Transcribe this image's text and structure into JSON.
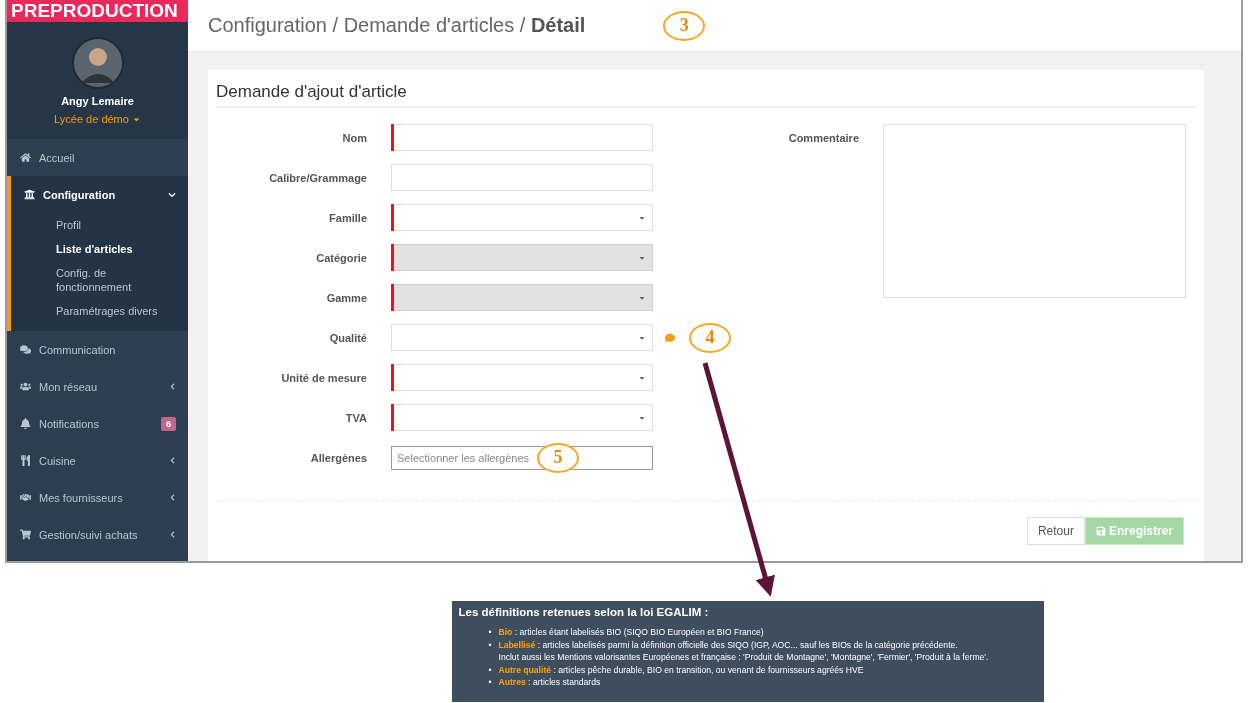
{
  "environment_banner": "PREPRODUCTION",
  "user": {
    "name": "Angy Lemaire",
    "school": "Lycée de démo"
  },
  "sidebar": {
    "items": [
      {
        "kind": "home",
        "label": "Accueil",
        "selected": false,
        "has_submenu": false
      },
      {
        "kind": "bank",
        "label": "Configuration",
        "selected": true,
        "expanded": true,
        "has_submenu": true,
        "children": [
          {
            "label": "Profil",
            "selected": false
          },
          {
            "label": "Liste d'articles",
            "selected": true
          },
          {
            "label": "Config. de fonctionnement",
            "selected": false
          },
          {
            "label": "Paramétrages divers",
            "selected": false
          }
        ]
      },
      {
        "kind": "comments",
        "label": "Communication",
        "selected": false,
        "has_submenu": false
      },
      {
        "kind": "users",
        "label": "Mon réseau",
        "selected": false,
        "has_submenu": true
      },
      {
        "kind": "bell",
        "label": "Notifications",
        "selected": false,
        "has_submenu": false,
        "badge": "6"
      },
      {
        "kind": "utensils",
        "label": "Cuisine",
        "selected": false,
        "has_submenu": true
      },
      {
        "kind": "handshake",
        "label": "Mes fournisseurs",
        "selected": false,
        "has_submenu": true
      },
      {
        "kind": "cart",
        "label": "Gestion/suivi achats",
        "selected": false,
        "has_submenu": true
      }
    ]
  },
  "header": {
    "breadcrumb": "Configuration / Demande d'articles / **Détail**",
    "annotation": "3"
  },
  "form": {
    "title": "Demande d'ajout d'article",
    "fields": [
      {
        "kind": "text",
        "label": "Nom",
        "required": true,
        "disabled": false
      },
      {
        "kind": "text",
        "label": "Calibre/Grammage",
        "required": false,
        "disabled": false
      },
      {
        "kind": "select",
        "label": "Famille",
        "required": true,
        "disabled": false
      },
      {
        "kind": "select",
        "label": "Catégorie",
        "required": true,
        "disabled": true
      },
      {
        "kind": "select",
        "label": "Gamme",
        "required": true,
        "disabled": true
      },
      {
        "kind": "select",
        "label": "Qualité",
        "required": false,
        "disabled": false,
        "has_info": true,
        "annotation": "4"
      },
      {
        "kind": "select",
        "label": "Unité de mesure",
        "required": true,
        "disabled": false
      },
      {
        "kind": "select",
        "label": "TVA",
        "required": true,
        "disabled": false
      },
      {
        "kind": "multiselect",
        "label": "Allergènes",
        "placeholder": "Selectionner les allergènes",
        "annotation": "5"
      }
    ],
    "comment": {
      "label": "Commentaire"
    },
    "buttons": [
      {
        "kind": "default",
        "label": "Retour",
        "disabled": false
      },
      {
        "kind": "save",
        "label": "Enregistrer",
        "disabled": true
      }
    ]
  },
  "tooltip": {
    "title": "Les définitions retenues selon la loi EGALIM :",
    "items": [
      {
        "marker": "•",
        "term": "Bio",
        "text": " : articles étant labelisés BIO (SIQO BIO Européen et BIO France)"
      },
      {
        "marker": "•",
        "term": "Labellisé",
        "text": " : articles labelisés parmi la définition officielle des SIQO (IGP, AOC... sauf les BIOs de la catégorie précédente.",
        "note": "Inclut aussi les Mentions valorisantes Européenes et française : 'Produit de Montagne', 'Montagne', 'Fermier', 'Produit à la ferme'."
      },
      {
        "marker": "•",
        "term": "Autre qualité",
        "text": " : articles pêche durable, BIO en transition, ou venant de fournisseurs agréés HVE"
      },
      {
        "marker": "•",
        "term": "Autres",
        "text": " : articles standards"
      }
    ]
  }
}
